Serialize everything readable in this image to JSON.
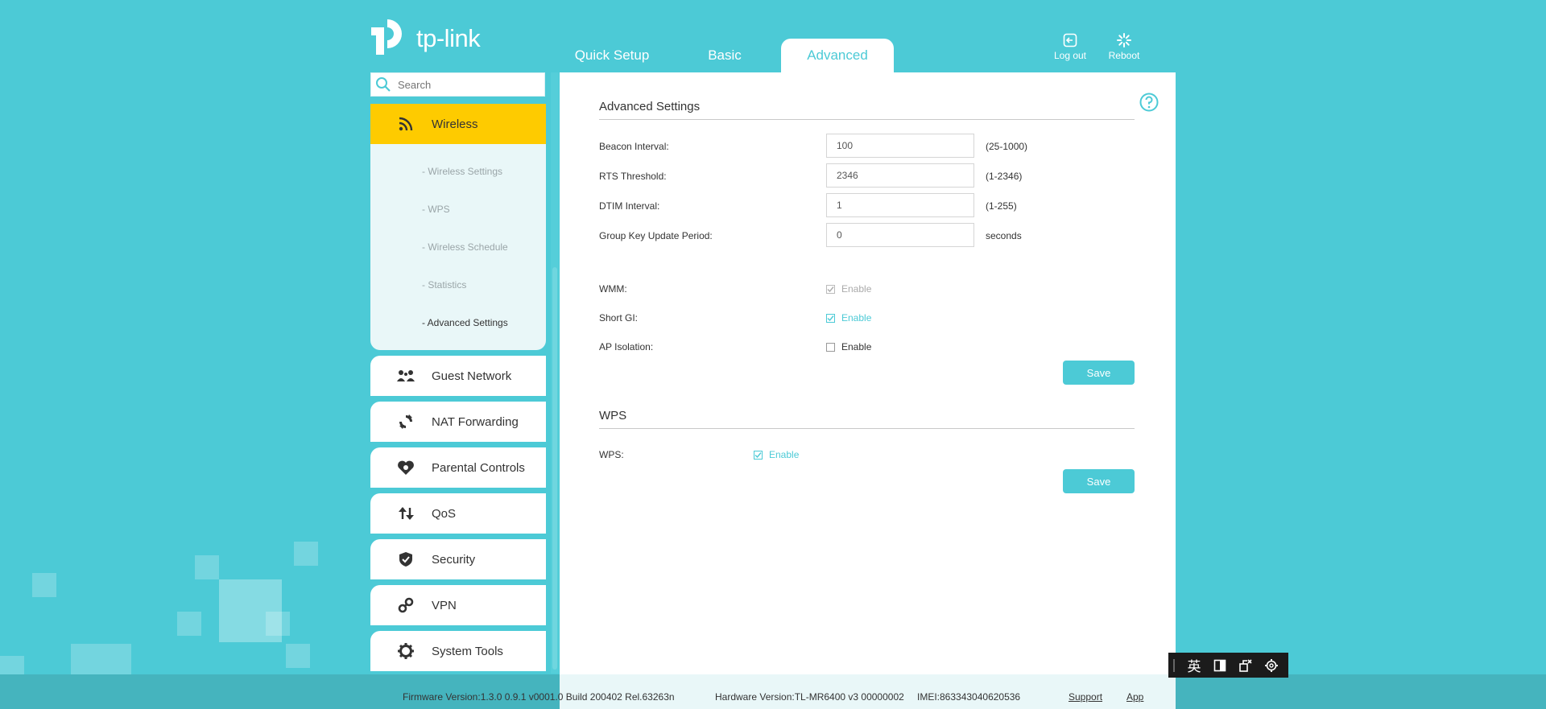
{
  "brand": {
    "name": "tp-link"
  },
  "tabs": [
    {
      "label": "Quick Setup",
      "active": false
    },
    {
      "label": "Basic",
      "active": false
    },
    {
      "label": "Advanced",
      "active": true
    }
  ],
  "header_actions": {
    "logout_label": "Log out",
    "reboot_label": "Reboot"
  },
  "search": {
    "placeholder": "Search",
    "value": ""
  },
  "sidebar": {
    "active_item": {
      "label": "Wireless",
      "icon": "wifi-icon"
    },
    "sub_items": [
      {
        "label": "- Wireless Settings",
        "current": false
      },
      {
        "label": "- WPS",
        "current": false
      },
      {
        "label": "- Wireless Schedule",
        "current": false
      },
      {
        "label": "- Statistics",
        "current": false
      },
      {
        "label": "- Advanced Settings",
        "current": true
      }
    ],
    "items": [
      {
        "label": "Guest Network",
        "icon": "guest-network-icon"
      },
      {
        "label": "NAT Forwarding",
        "icon": "nat-forwarding-icon"
      },
      {
        "label": "Parental Controls",
        "icon": "parental-controls-icon"
      },
      {
        "label": "QoS",
        "icon": "qos-icon"
      },
      {
        "label": "Security",
        "icon": "shield-icon"
      },
      {
        "label": "VPN",
        "icon": "vpn-icon"
      },
      {
        "label": "System Tools",
        "icon": "gear-icon"
      }
    ]
  },
  "advanced_settings": {
    "title": "Advanced Settings",
    "fields": [
      {
        "label": "Beacon Interval:",
        "value": "100",
        "hint": "(25-1000)"
      },
      {
        "label": "RTS Threshold:",
        "value": "2346",
        "hint": "(1-2346)"
      },
      {
        "label": "DTIM Interval:",
        "value": "1",
        "hint": "(1-255)"
      },
      {
        "label": "Group Key Update Period:",
        "value": "0",
        "hint": "seconds"
      }
    ],
    "checkboxes": [
      {
        "label": "WMM:",
        "option": "Enable",
        "checked": true,
        "disabled": true
      },
      {
        "label": "Short GI:",
        "option": "Enable",
        "checked": true,
        "disabled": false
      },
      {
        "label": "AP Isolation:",
        "option": "Enable",
        "checked": false,
        "disabled": false
      }
    ],
    "save_label": "Save"
  },
  "wps": {
    "title": "WPS",
    "label": "WPS:",
    "option": "Enable",
    "checked": true,
    "save_label": "Save"
  },
  "footer": {
    "firmware": "Firmware Version:1.3.0 0.9.1 v0001.0 Build 200402 Rel.63263n",
    "hardware": "Hardware Version:TL-MR6400 v3 00000002",
    "imei": "IMEI:863343040620536",
    "support_label": "Support",
    "app_label": "App"
  },
  "ime_toolbar": {
    "lang_label": "英"
  },
  "colors": {
    "accent": "#4ccad6",
    "active_menu": "#fecb00",
    "submenu_bg": "#e9f7f8"
  }
}
